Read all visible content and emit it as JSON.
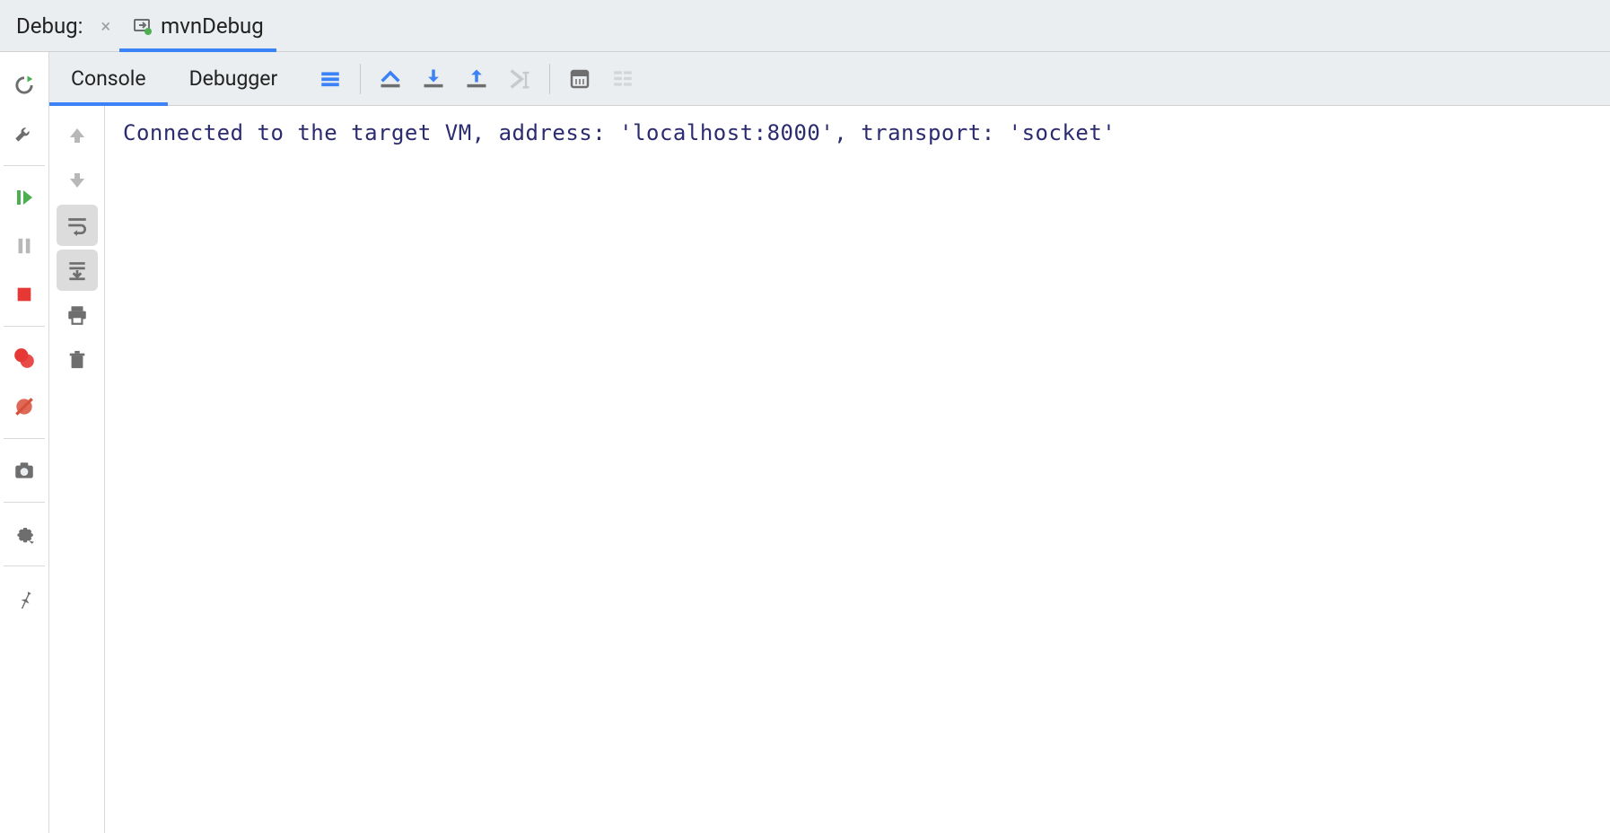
{
  "panel_title": "Debug:",
  "run_config": {
    "name": "mvnDebug"
  },
  "tabs": [
    {
      "label": "Console",
      "active": true
    },
    {
      "label": "Debugger",
      "active": false
    }
  ],
  "left_rail": {
    "rerun": "rerun-icon",
    "modify_run": "wrench-icon",
    "resume": "resume-icon",
    "pause": "pause-icon",
    "stop": "stop-icon",
    "breakpoints": "breakpoints-icon",
    "mute_breakpoints": "mute-breakpoints-icon",
    "thread_dump": "camera-icon",
    "settings": "gear-icon",
    "pin": "pin-icon"
  },
  "tab_toolbar": {
    "show_threads": "threads-icon",
    "step_over": "step-over-icon",
    "step_into": "step-into-icon",
    "step_out": "step-out-icon",
    "run_to_cursor": "run-to-cursor-icon",
    "evaluate": "evaluate-icon",
    "trace": "trace-icon"
  },
  "console_rail": {
    "up": "up-arrow-icon",
    "down": "down-arrow-icon",
    "soft_wrap": "soft-wrap-icon",
    "scroll_to_end": "scroll-to-end-icon",
    "print": "print-icon",
    "clear": "trash-icon"
  },
  "console": {
    "line1": "Connected to the target VM, address: 'localhost:8000', transport: 'socket'"
  },
  "colors": {
    "accent": "#3b82f6",
    "green": "#4caf50",
    "red": "#e53935",
    "orange": "#d94f3a",
    "gray": "#6e6e6e",
    "text_blue": "#2b2b6f"
  }
}
